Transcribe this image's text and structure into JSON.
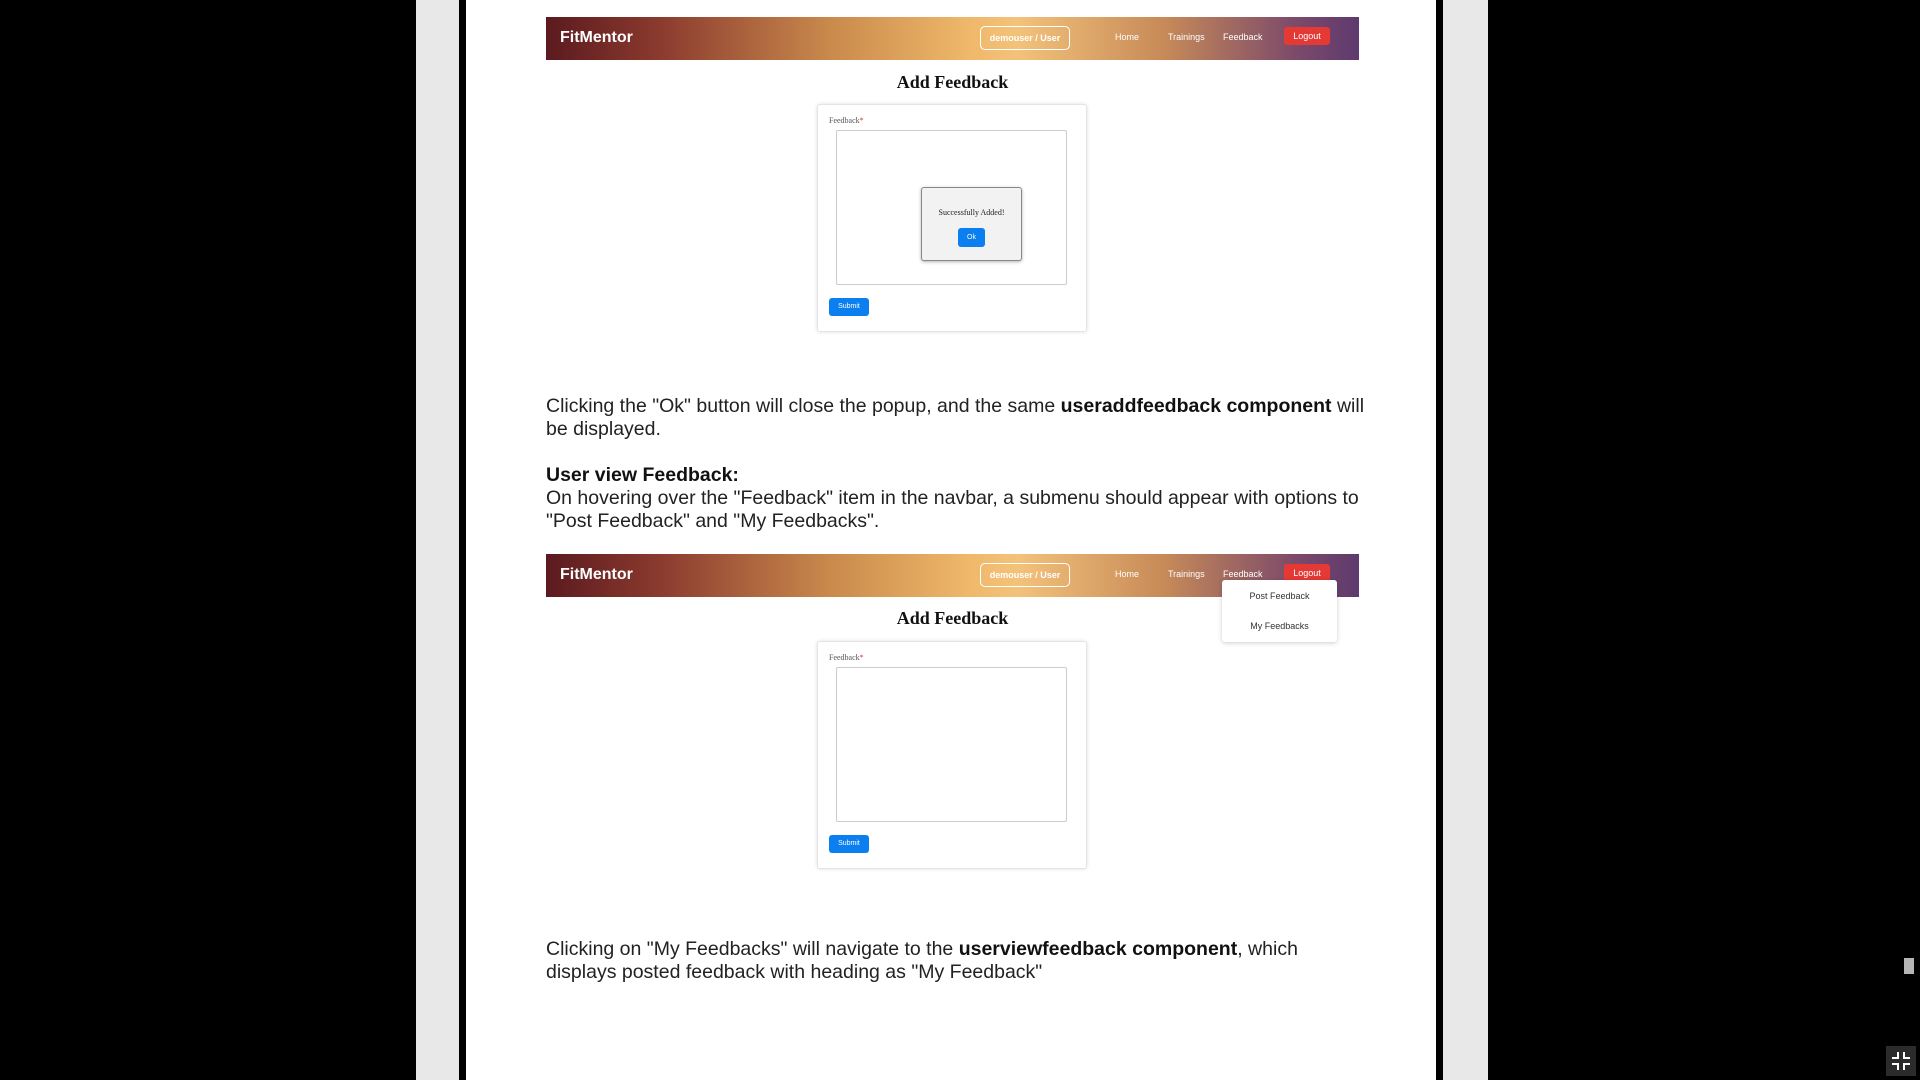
{
  "screenshot1": {
    "brand": "FitMentor",
    "user_button": "demouser / User",
    "nav": [
      "Home",
      "Trainings",
      "Feedback"
    ],
    "logout": "Logout",
    "title": "Add Feedback",
    "field_label": "Feedback",
    "required_mark": "*",
    "popup_message": "Successfully Added!",
    "popup_ok": "Ok",
    "submit": "Submit"
  },
  "para1": {
    "text_before": "Clicking the \"Ok\" button will close the popup, and the same ",
    "bold": "useraddfeedback component",
    "text_after": " will be displayed."
  },
  "section": {
    "heading": "User view Feedback:",
    "text": "On hovering over the \"Feedback\" item in the navbar, a submenu should appear with options to \"Post Feedback\" and \"My Feedbacks\"."
  },
  "screenshot2": {
    "brand": "FitMentor",
    "user_button": "demouser / User",
    "nav": [
      "Home",
      "Trainings",
      "Feedback"
    ],
    "logout": "Logout",
    "dropdown": [
      "Post Feedback",
      "My Feedbacks"
    ],
    "title": "Add Feedback",
    "field_label": "Feedback",
    "required_mark": "*",
    "submit": "Submit"
  },
  "para2": {
    "text_before": "Clicking on \"My Feedbacks\" will navigate to the ",
    "bold": "userviewfeedback component",
    "text_after": ", which displays posted feedback with heading as \"My Feedback\""
  },
  "colors": {
    "accent_blue": "#0b7ef0",
    "logout_red": "#e53935"
  },
  "icons": {
    "exit_fullscreen": "exit-fullscreen-icon"
  }
}
